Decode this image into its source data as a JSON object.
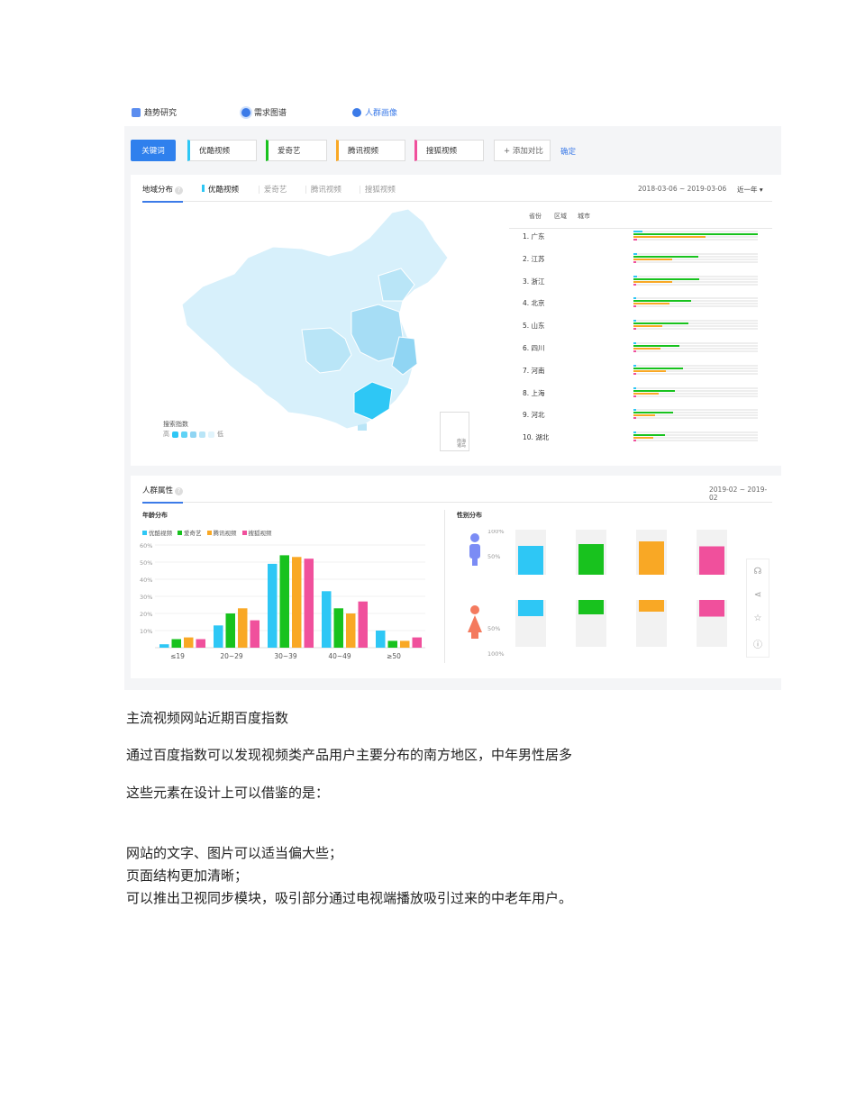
{
  "topnav": {
    "items": [
      {
        "label": "趋势研究",
        "icon": "trend-chart-icon"
      },
      {
        "label": "需求图谱",
        "icon": "radar-icon"
      },
      {
        "label": "人群画像",
        "icon": "user-icon"
      }
    ]
  },
  "keywords": {
    "main": "关键词",
    "chips": [
      {
        "label": "优酷视频",
        "color": "#2ec7f5"
      },
      {
        "label": "爱奇艺",
        "color": "#18c21e"
      },
      {
        "label": "腾讯视频",
        "color": "#f9a825"
      },
      {
        "label": "搜狐视频",
        "color": "#f0509c"
      }
    ],
    "add": "+ 添加对比",
    "confirm": "确定"
  },
  "region": {
    "title": "地域分布",
    "tabs": [
      "优酷视频",
      "爱奇艺",
      "腾讯视频",
      "搜狐视频"
    ],
    "date": "2018-03-06 ~ 2019-03-06",
    "period": "近一年",
    "subtabs": [
      "省份",
      "区域",
      "城市"
    ],
    "legend_title": "搜索指数",
    "legend_high": "高",
    "legend_low": "低",
    "inset_label": "南海\n诸岛"
  },
  "ranking": [
    {
      "label": "1.  广东",
      "values": [
        0.07,
        1.0,
        0.58,
        0.03
      ]
    },
    {
      "label": "2.  江苏",
      "values": [
        0.03,
        0.52,
        0.31,
        0.02
      ]
    },
    {
      "label": "3.  浙江",
      "values": [
        0.03,
        0.53,
        0.31,
        0.02
      ]
    },
    {
      "label": "4.  北京",
      "values": [
        0.02,
        0.46,
        0.29,
        0.02
      ]
    },
    {
      "label": "5.  山东",
      "values": [
        0.02,
        0.44,
        0.23,
        0.02
      ]
    },
    {
      "label": "6.  四川",
      "values": [
        0.02,
        0.37,
        0.22,
        0.02
      ]
    },
    {
      "label": "7.  河南",
      "values": [
        0.02,
        0.4,
        0.26,
        0.02
      ]
    },
    {
      "label": "8.  上海",
      "values": [
        0.02,
        0.33,
        0.2,
        0.02
      ]
    },
    {
      "label": "9.  河北",
      "values": [
        0.02,
        0.32,
        0.17,
        0.02
      ]
    },
    {
      "label": "10.  湖北",
      "values": [
        0.02,
        0.25,
        0.16,
        0.02
      ]
    }
  ],
  "crowd": {
    "title": "人群属性",
    "date": "2019-02 ~ 2019-02",
    "age_title": "年龄分布",
    "gender_title": "性别分布",
    "gender_ticks": [
      "100%",
      "50%",
      "50%",
      "100%"
    ]
  },
  "chart_data": [
    {
      "type": "bar",
      "categories": [
        "≤19",
        "20~29",
        "30~39",
        "40~49",
        "≥50"
      ],
      "series": [
        {
          "name": "优酷视频",
          "color": "#2ec7f5",
          "values": [
            2,
            13,
            49,
            33,
            10
          ]
        },
        {
          "name": "爱奇艺",
          "color": "#18c21e",
          "values": [
            5,
            20,
            54,
            23,
            4
          ]
        },
        {
          "name": "腾讯视频",
          "color": "#f9a825",
          "values": [
            6,
            23,
            53,
            20,
            4
          ]
        },
        {
          "name": "搜狐视频",
          "color": "#f0509c",
          "values": [
            5,
            16,
            52,
            27,
            6
          ]
        }
      ],
      "yticks": [
        "60%",
        "50%",
        "40%",
        "30%",
        "20%",
        "10%"
      ],
      "ylim": [
        0,
        60
      ]
    },
    {
      "type": "bar",
      "categories": [
        "男",
        "女"
      ],
      "series": [
        {
          "name": "优酷视频",
          "color": "#2ec7f5",
          "values": [
            64,
            36
          ]
        },
        {
          "name": "爱奇艺",
          "color": "#18c21e",
          "values": [
            68,
            32
          ]
        },
        {
          "name": "腾讯视频",
          "color": "#f9a825",
          "values": [
            74,
            26
          ]
        },
        {
          "name": "搜狐视频",
          "color": "#f0509c",
          "values": [
            63,
            37
          ]
        }
      ]
    }
  ],
  "caption": "主流视频网站近期百度指数",
  "paragraphs": [
    "通过百度指数可以发现视频类产品用户主要分布的南方地区，中年男性居多",
    "这些元素在设计上可以借鉴的是："
  ],
  "list": [
    "网站的文字、图片可以适当偏大些；",
    "页面结构更加清晰；",
    "可以推出卫视同步模块，吸引部分通过电视端播放吸引过来的中老年用户。"
  ]
}
